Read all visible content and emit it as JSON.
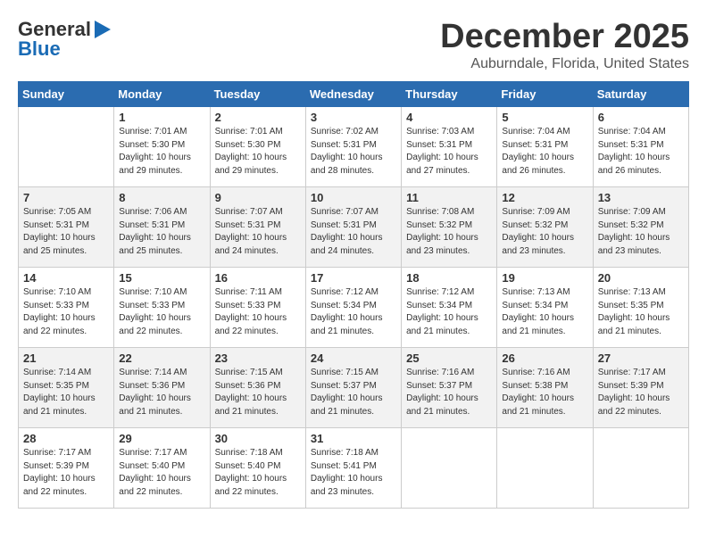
{
  "header": {
    "logo_general": "General",
    "logo_blue": "Blue",
    "month": "December 2025",
    "location": "Auburndale, Florida, United States"
  },
  "weekdays": [
    "Sunday",
    "Monday",
    "Tuesday",
    "Wednesday",
    "Thursday",
    "Friday",
    "Saturday"
  ],
  "weeks": [
    [
      {
        "day": "",
        "sunrise": "",
        "sunset": "",
        "daylight": ""
      },
      {
        "day": "1",
        "sunrise": "Sunrise: 7:01 AM",
        "sunset": "Sunset: 5:30 PM",
        "daylight": "Daylight: 10 hours and 29 minutes."
      },
      {
        "day": "2",
        "sunrise": "Sunrise: 7:01 AM",
        "sunset": "Sunset: 5:30 PM",
        "daylight": "Daylight: 10 hours and 29 minutes."
      },
      {
        "day": "3",
        "sunrise": "Sunrise: 7:02 AM",
        "sunset": "Sunset: 5:31 PM",
        "daylight": "Daylight: 10 hours and 28 minutes."
      },
      {
        "day": "4",
        "sunrise": "Sunrise: 7:03 AM",
        "sunset": "Sunset: 5:31 PM",
        "daylight": "Daylight: 10 hours and 27 minutes."
      },
      {
        "day": "5",
        "sunrise": "Sunrise: 7:04 AM",
        "sunset": "Sunset: 5:31 PM",
        "daylight": "Daylight: 10 hours and 26 minutes."
      },
      {
        "day": "6",
        "sunrise": "Sunrise: 7:04 AM",
        "sunset": "Sunset: 5:31 PM",
        "daylight": "Daylight: 10 hours and 26 minutes."
      }
    ],
    [
      {
        "day": "7",
        "sunrise": "Sunrise: 7:05 AM",
        "sunset": "Sunset: 5:31 PM",
        "daylight": "Daylight: 10 hours and 25 minutes."
      },
      {
        "day": "8",
        "sunrise": "Sunrise: 7:06 AM",
        "sunset": "Sunset: 5:31 PM",
        "daylight": "Daylight: 10 hours and 25 minutes."
      },
      {
        "day": "9",
        "sunrise": "Sunrise: 7:07 AM",
        "sunset": "Sunset: 5:31 PM",
        "daylight": "Daylight: 10 hours and 24 minutes."
      },
      {
        "day": "10",
        "sunrise": "Sunrise: 7:07 AM",
        "sunset": "Sunset: 5:31 PM",
        "daylight": "Daylight: 10 hours and 24 minutes."
      },
      {
        "day": "11",
        "sunrise": "Sunrise: 7:08 AM",
        "sunset": "Sunset: 5:32 PM",
        "daylight": "Daylight: 10 hours and 23 minutes."
      },
      {
        "day": "12",
        "sunrise": "Sunrise: 7:09 AM",
        "sunset": "Sunset: 5:32 PM",
        "daylight": "Daylight: 10 hours and 23 minutes."
      },
      {
        "day": "13",
        "sunrise": "Sunrise: 7:09 AM",
        "sunset": "Sunset: 5:32 PM",
        "daylight": "Daylight: 10 hours and 23 minutes."
      }
    ],
    [
      {
        "day": "14",
        "sunrise": "Sunrise: 7:10 AM",
        "sunset": "Sunset: 5:33 PM",
        "daylight": "Daylight: 10 hours and 22 minutes."
      },
      {
        "day": "15",
        "sunrise": "Sunrise: 7:10 AM",
        "sunset": "Sunset: 5:33 PM",
        "daylight": "Daylight: 10 hours and 22 minutes."
      },
      {
        "day": "16",
        "sunrise": "Sunrise: 7:11 AM",
        "sunset": "Sunset: 5:33 PM",
        "daylight": "Daylight: 10 hours and 22 minutes."
      },
      {
        "day": "17",
        "sunrise": "Sunrise: 7:12 AM",
        "sunset": "Sunset: 5:34 PM",
        "daylight": "Daylight: 10 hours and 21 minutes."
      },
      {
        "day": "18",
        "sunrise": "Sunrise: 7:12 AM",
        "sunset": "Sunset: 5:34 PM",
        "daylight": "Daylight: 10 hours and 21 minutes."
      },
      {
        "day": "19",
        "sunrise": "Sunrise: 7:13 AM",
        "sunset": "Sunset: 5:34 PM",
        "daylight": "Daylight: 10 hours and 21 minutes."
      },
      {
        "day": "20",
        "sunrise": "Sunrise: 7:13 AM",
        "sunset": "Sunset: 5:35 PM",
        "daylight": "Daylight: 10 hours and 21 minutes."
      }
    ],
    [
      {
        "day": "21",
        "sunrise": "Sunrise: 7:14 AM",
        "sunset": "Sunset: 5:35 PM",
        "daylight": "Daylight: 10 hours and 21 minutes."
      },
      {
        "day": "22",
        "sunrise": "Sunrise: 7:14 AM",
        "sunset": "Sunset: 5:36 PM",
        "daylight": "Daylight: 10 hours and 21 minutes."
      },
      {
        "day": "23",
        "sunrise": "Sunrise: 7:15 AM",
        "sunset": "Sunset: 5:36 PM",
        "daylight": "Daylight: 10 hours and 21 minutes."
      },
      {
        "day": "24",
        "sunrise": "Sunrise: 7:15 AM",
        "sunset": "Sunset: 5:37 PM",
        "daylight": "Daylight: 10 hours and 21 minutes."
      },
      {
        "day": "25",
        "sunrise": "Sunrise: 7:16 AM",
        "sunset": "Sunset: 5:37 PM",
        "daylight": "Daylight: 10 hours and 21 minutes."
      },
      {
        "day": "26",
        "sunrise": "Sunrise: 7:16 AM",
        "sunset": "Sunset: 5:38 PM",
        "daylight": "Daylight: 10 hours and 21 minutes."
      },
      {
        "day": "27",
        "sunrise": "Sunrise: 7:17 AM",
        "sunset": "Sunset: 5:39 PM",
        "daylight": "Daylight: 10 hours and 22 minutes."
      }
    ],
    [
      {
        "day": "28",
        "sunrise": "Sunrise: 7:17 AM",
        "sunset": "Sunset: 5:39 PM",
        "daylight": "Daylight: 10 hours and 22 minutes."
      },
      {
        "day": "29",
        "sunrise": "Sunrise: 7:17 AM",
        "sunset": "Sunset: 5:40 PM",
        "daylight": "Daylight: 10 hours and 22 minutes."
      },
      {
        "day": "30",
        "sunrise": "Sunrise: 7:18 AM",
        "sunset": "Sunset: 5:40 PM",
        "daylight": "Daylight: 10 hours and 22 minutes."
      },
      {
        "day": "31",
        "sunrise": "Sunrise: 7:18 AM",
        "sunset": "Sunset: 5:41 PM",
        "daylight": "Daylight: 10 hours and 23 minutes."
      },
      {
        "day": "",
        "sunrise": "",
        "sunset": "",
        "daylight": ""
      },
      {
        "day": "",
        "sunrise": "",
        "sunset": "",
        "daylight": ""
      },
      {
        "day": "",
        "sunrise": "",
        "sunset": "",
        "daylight": ""
      }
    ]
  ]
}
